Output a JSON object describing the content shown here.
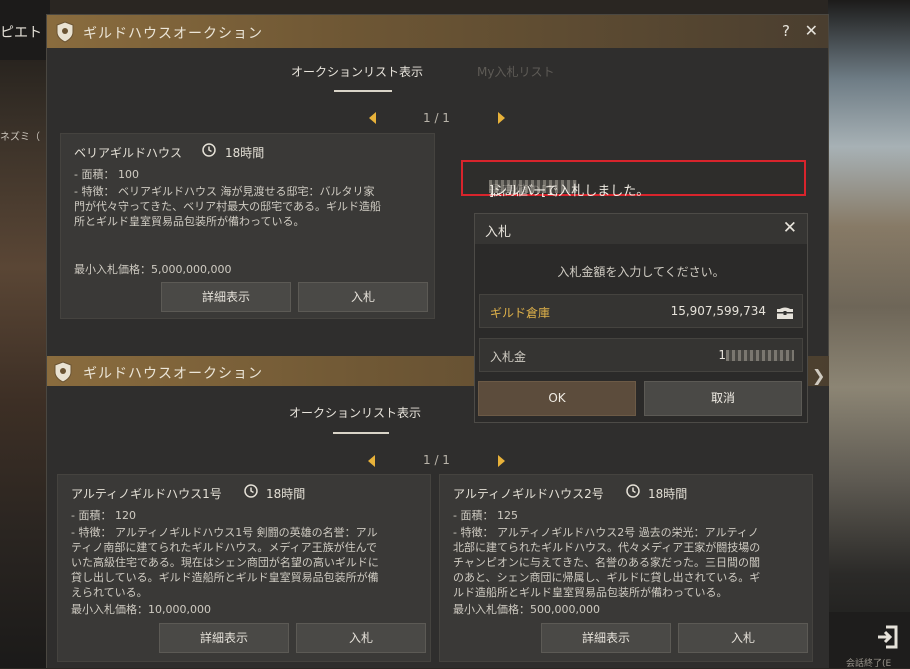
{
  "background": {
    "left_text": "ピエト",
    "small_text": "ネズミ（",
    "exit_label": "会話終了(E"
  },
  "main_window": {
    "title": "ギルドハウスオークション",
    "help_label": "?",
    "close_label": "✕",
    "tabs": [
      {
        "label": "オークションリスト表示",
        "active": true
      },
      {
        "label": "My入札リスト",
        "active": false
      }
    ],
    "pager": "1 / 1",
    "card": {
      "name": "ベリアギルドハウス",
      "time": "18時間",
      "area": "- 面積： 100",
      "feature_lines": [
        "- 特徴： ベリアギルドハウス 海が見渡せる邸宅：バルタリ家",
        "門が代々守ってきた、ベリア村最大の邸宅である。ギルド造船",
        "所とギルド皇室貿易品包装所が備わっている。"
      ],
      "min_bid": "最小入札価格：5,000,000,000",
      "detail_button": "詳細表示",
      "bid_button": "入札"
    }
  },
  "notice": {
    "prefix": "最高値の[1,",
    "suffix": "]シルバーで入札しました。"
  },
  "bid_dialog": {
    "title": "入札",
    "close_label": "✕",
    "prompt": "入札金額を入力してください。",
    "warehouse_label": "ギルド倉庫",
    "warehouse_value": "15,907,599,734",
    "bid_label": "入札金",
    "bid_value_prefix": "1",
    "ok_label": "OK",
    "cancel_label": "取消"
  },
  "second_window": {
    "title": "ギルドハウスオークション",
    "tab_label": "オークションリスト表示",
    "pager": "1 / 1",
    "cards": [
      {
        "name": "アルティノギルドハウス1号",
        "time": "18時間",
        "area": "- 面積： 120",
        "feature_lines": [
          "- 特徴： アルティノギルドハウス1号 剣闘の英雄の名誉：アル",
          "ティノ南部に建てられたギルドハウス。メディア王族が住んで",
          "いた高級住宅である。現在はシェン商団が名望の高いギルドに",
          "貸し出している。ギルド造船所とギルド皇室貿易品包装所が備",
          "えられている。"
        ],
        "min_bid": "最小入札価格：10,000,000",
        "detail_button": "詳細表示",
        "bid_button": "入札"
      },
      {
        "name": "アルティノギルドハウス2号",
        "time": "18時間",
        "area": "- 面積： 125",
        "feature_lines": [
          "- 特徴： アルティノギルドハウス2号 過去の栄光：アルティノ",
          "北部に建てられたギルドハウス。代々メディア王家が闘技場の",
          "チャンピオンに与えてきた、名誉のある家だった。三日間の闇",
          "のあと、シェン商団に帰属し、ギルドに貸し出されている。ギ",
          "ルド造船所とギルド皇室貿易品包装所が備わっている。"
        ],
        "min_bid": "最小入札価格：500,000,000",
        "detail_button": "詳細表示",
        "bid_button": "入札"
      }
    ]
  },
  "colors": {
    "accent_gold": "#e8b23a",
    "notice_border": "#d8242c",
    "warehouse_label": "#e0b24a",
    "ok_button": "#5c4c3c"
  }
}
